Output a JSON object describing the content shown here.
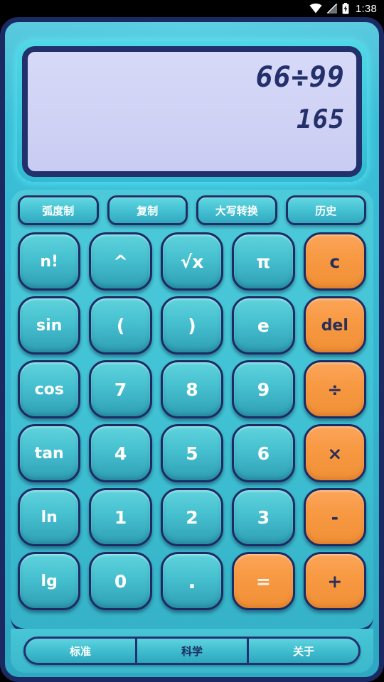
{
  "statusbar": {
    "time": "1:38",
    "icons": [
      "wifi-icon",
      "signal-icon",
      "battery-charging-icon"
    ]
  },
  "display": {
    "expression": "66÷99",
    "result": "165"
  },
  "utility_buttons": [
    {
      "label": "弧度制",
      "name": "radian-mode-button"
    },
    {
      "label": "复制",
      "name": "copy-button"
    },
    {
      "label": "大写转换",
      "name": "uppercase-convert-button"
    },
    {
      "label": "历史",
      "name": "history-button"
    }
  ],
  "keypad": {
    "rows": [
      [
        {
          "label": "n!",
          "style": "cyan"
        },
        {
          "label": "^",
          "style": "cyan"
        },
        {
          "label": "√x",
          "style": "cyan"
        },
        {
          "label": "π",
          "style": "cyan"
        },
        {
          "label": "c",
          "style": "orange"
        }
      ],
      [
        {
          "label": "sin",
          "style": "cyan"
        },
        {
          "label": "(",
          "style": "cyan"
        },
        {
          "label": ")",
          "style": "cyan"
        },
        {
          "label": "e",
          "style": "cyan"
        },
        {
          "label": "del",
          "style": "orange"
        }
      ],
      [
        {
          "label": "cos",
          "style": "cyan"
        },
        {
          "label": "7",
          "style": "cyan"
        },
        {
          "label": "8",
          "style": "cyan"
        },
        {
          "label": "9",
          "style": "cyan"
        },
        {
          "label": "÷",
          "style": "orange"
        }
      ],
      [
        {
          "label": "tan",
          "style": "cyan"
        },
        {
          "label": "4",
          "style": "cyan"
        },
        {
          "label": "5",
          "style": "cyan"
        },
        {
          "label": "6",
          "style": "cyan"
        },
        {
          "label": "×",
          "style": "orange"
        }
      ],
      [
        {
          "label": "ln",
          "style": "cyan"
        },
        {
          "label": "1",
          "style": "cyan"
        },
        {
          "label": "2",
          "style": "cyan"
        },
        {
          "label": "3",
          "style": "cyan"
        },
        {
          "label": "-",
          "style": "orange"
        }
      ],
      [
        {
          "label": "lg",
          "style": "cyan"
        },
        {
          "label": "0",
          "style": "cyan"
        },
        {
          "label": ".",
          "style": "cyan"
        },
        {
          "label": "=",
          "style": "orange-light"
        },
        {
          "label": "+",
          "style": "orange"
        }
      ]
    ]
  },
  "tabs": [
    {
      "label": "标准",
      "active": false,
      "name": "tab-standard"
    },
    {
      "label": "科学",
      "active": true,
      "name": "tab-scientific"
    },
    {
      "label": "关于",
      "active": false,
      "name": "tab-about"
    }
  ],
  "colors": {
    "frame_border": "#1b2a63",
    "body_cyan": "#3cbed5",
    "key_cyan": "#46c0cf",
    "key_orange": "#f89a44",
    "display_bg": "#d3d5f6",
    "lcd_text": "#24306b"
  }
}
